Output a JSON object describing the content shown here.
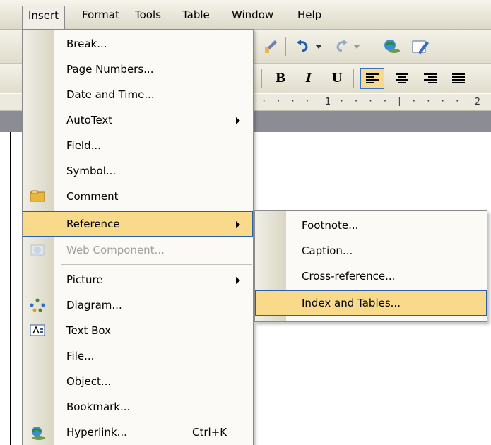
{
  "menubar": {
    "insert": "Insert",
    "format": "Format",
    "tools": "Tools",
    "table": "Table",
    "window": "Window",
    "help": "Help"
  },
  "toolbar": {
    "bold": "B",
    "italic": "I",
    "underline": "U"
  },
  "ruler": {
    "mark1": "1",
    "mark2": "2"
  },
  "insert_menu": {
    "items": [
      {
        "label": "Break...",
        "icon": null
      },
      {
        "label": "Page Numbers...",
        "icon": null
      },
      {
        "label": "Date and Time...",
        "icon": null
      },
      {
        "label": "AutoText",
        "icon": null,
        "submenu": true
      },
      {
        "label": "Field...",
        "icon": null
      },
      {
        "label": "Symbol...",
        "icon": null
      },
      {
        "label": "Comment",
        "icon": "comment-icon"
      },
      {
        "label": "Reference",
        "icon": null,
        "submenu": true,
        "highlighted": true
      },
      {
        "label": "Web Component...",
        "icon": "web-component-icon",
        "disabled": true
      },
      {
        "label": "Picture",
        "icon": null,
        "submenu": true
      },
      {
        "label": "Diagram...",
        "icon": "diagram-icon"
      },
      {
        "label": "Text Box",
        "icon": "text-box-icon"
      },
      {
        "label": "File...",
        "icon": null
      },
      {
        "label": "Object...",
        "icon": null
      },
      {
        "label": "Bookmark...",
        "icon": null
      },
      {
        "label": "Hyperlink...",
        "icon": "hyperlink-icon",
        "shortcut": "Ctrl+K"
      }
    ]
  },
  "reference_submenu": {
    "items": [
      {
        "label": "Footnote..."
      },
      {
        "label": "Caption..."
      },
      {
        "label": "Cross-reference..."
      },
      {
        "label": "Index and Tables...",
        "highlighted": true
      }
    ]
  },
  "colors": {
    "highlight": "#f9d98a",
    "highlight_border": "#2f5ea8"
  }
}
